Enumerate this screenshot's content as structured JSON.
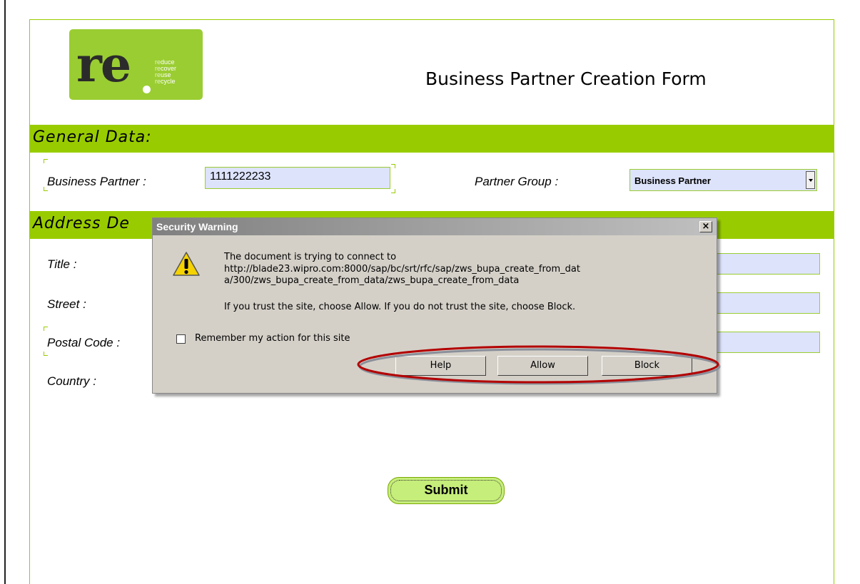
{
  "logo": {
    "mark": "re",
    "words": [
      {
        "prefix": "re",
        "rest": "duce"
      },
      {
        "prefix": "re",
        "rest": "cover"
      },
      {
        "prefix": "re",
        "rest": "use"
      },
      {
        "prefix": "re",
        "rest": "cycle"
      }
    ],
    "color": "#9acd32"
  },
  "page": {
    "title": "Business Partner Creation Form",
    "accent_color": "#99cc00",
    "field_bg": "#dde3fb"
  },
  "general_section": {
    "title": "General Data:",
    "business_partner_label": "Business Partner :",
    "business_partner_value": "1111222233",
    "partner_group_label": "Partner Group :",
    "partner_group_value": "Business Partner"
  },
  "address_section": {
    "title": "Address De",
    "title_label": "Title :",
    "street_label": "Street :",
    "postal_code_label": "Postal Code :",
    "country_label": "Country :"
  },
  "submit_label": "Submit",
  "dialog": {
    "title": "Security Warning",
    "close_glyph": "×",
    "line1": "The document is trying to connect to",
    "line2": "http://blade23.wipro.com:8000/sap/bc/srt/rfc/sap/zws_bupa_create_from_dat",
    "line3": "a/300/zws_bupa_create_from_data/zws_bupa_create_from_data",
    "line4": "If you trust the site, choose Allow. If you do not trust the site, choose Block.",
    "remember_label": "Remember my action for this site",
    "remember_checked": false,
    "help_label": "Help",
    "allow_label": "Allow",
    "block_label": "Block"
  }
}
